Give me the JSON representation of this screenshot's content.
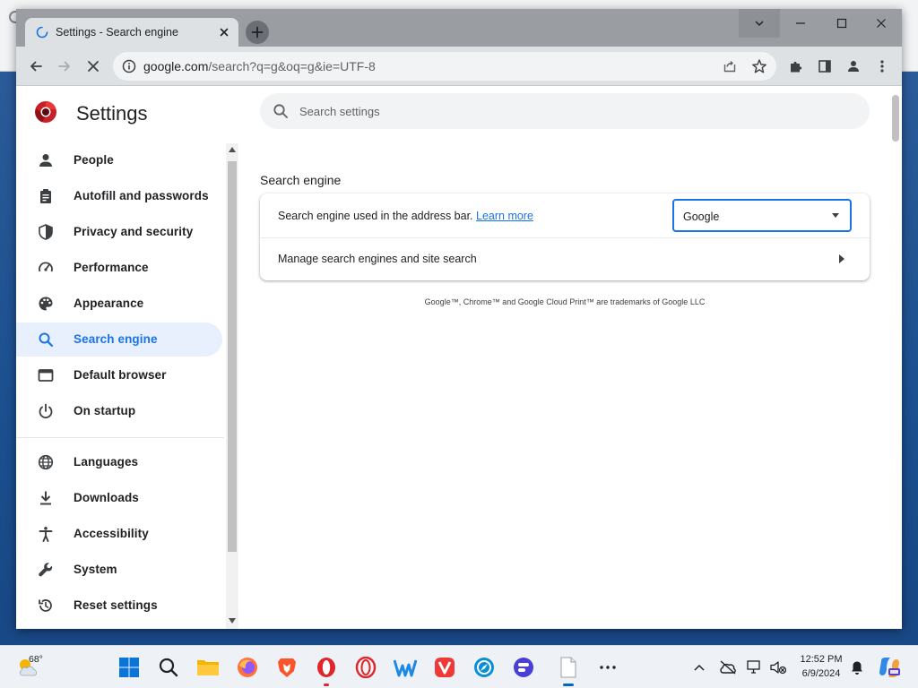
{
  "browser": {
    "tab": {
      "title": "Settings - Search engine"
    },
    "omnibox": {
      "url_host": "google.com",
      "url_path": "/search?q=g&oq=g&ie=UTF-8"
    }
  },
  "settings": {
    "title": "Settings",
    "search_placeholder": "Search settings",
    "nav": [
      {
        "label": "People",
        "icon": "person-icon"
      },
      {
        "label": "Autofill and passwords",
        "icon": "clipboard-icon"
      },
      {
        "label": "Privacy and security",
        "icon": "shield-icon"
      },
      {
        "label": "Performance",
        "icon": "speedometer-icon"
      },
      {
        "label": "Appearance",
        "icon": "palette-icon"
      },
      {
        "label": "Search engine",
        "icon": "search-icon",
        "active": true
      },
      {
        "label": "Default browser",
        "icon": "browser-window-icon"
      },
      {
        "label": "On startup",
        "icon": "power-icon"
      },
      {
        "label": "Languages",
        "icon": "globe-icon"
      },
      {
        "label": "Downloads",
        "icon": "download-icon"
      },
      {
        "label": "Accessibility",
        "icon": "accessibility-icon"
      },
      {
        "label": "System",
        "icon": "wrench-icon"
      },
      {
        "label": "Reset settings",
        "icon": "reset-icon"
      }
    ],
    "section_title": "Search engine",
    "engine_row": {
      "label": "Search engine used in the address bar.",
      "link": "Learn more",
      "selected": "Google"
    },
    "manage_row": {
      "label": "Manage search engines and site search"
    },
    "trademark": "Google™, Chrome™ and Google Cloud Print™ are trademarks of Google LLC"
  },
  "taskbar": {
    "weather_temp": "68°",
    "time": "12:52 PM",
    "date": "6/9/2024"
  },
  "colors": {
    "accent": "#1a73e8",
    "active_nav_bg": "#e8f0fe",
    "taskbar_bg": "#eef2f7"
  }
}
